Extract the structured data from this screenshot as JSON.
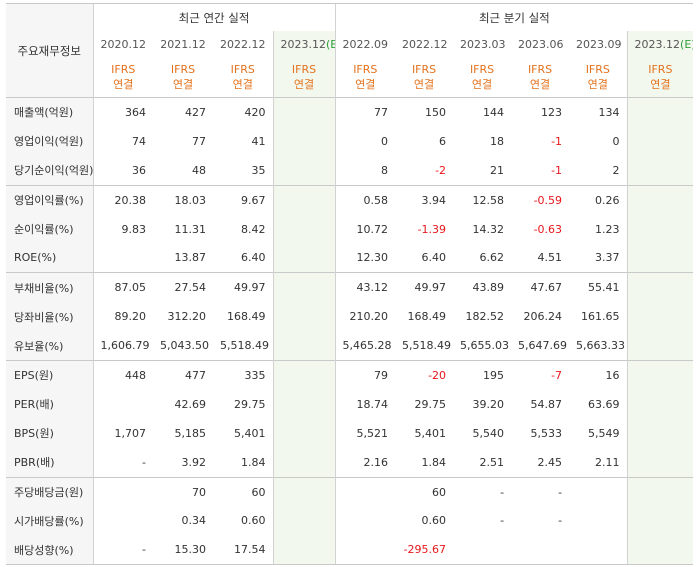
{
  "header": {
    "corner_label": "주요재무정보",
    "annual_group": "최근 연간 실적",
    "quarterly_group": "최근 분기 실적",
    "annual_periods": [
      "2020.12",
      "2021.12",
      "2022.12",
      "2023.12"
    ],
    "annual_estimate_suffix": "(E)",
    "quarterly_periods": [
      "2022.09",
      "2022.12",
      "2023.03",
      "2023.06",
      "2023.09",
      "2023.12"
    ],
    "quarterly_estimate_suffix": "(E)",
    "standard_line1": "IFRS",
    "standard_line2": "연결"
  },
  "rows": [
    {
      "label": "매출액(억원)",
      "values": [
        "364",
        "427",
        "420",
        "",
        "77",
        "150",
        "144",
        "123",
        "134",
        ""
      ]
    },
    {
      "label": "영업이익(억원)",
      "values": [
        "74",
        "77",
        "41",
        "",
        "0",
        "6",
        "18",
        "-1",
        "0",
        ""
      ]
    },
    {
      "label": "당기순이익(억원)",
      "values": [
        "36",
        "48",
        "35",
        "",
        "8",
        "-2",
        "21",
        "-1",
        "2",
        ""
      ]
    },
    {
      "label": "영업이익률(%)",
      "values": [
        "20.38",
        "18.03",
        "9.67",
        "",
        "0.58",
        "3.94",
        "12.58",
        "-0.59",
        "0.26",
        ""
      ]
    },
    {
      "label": "순이익률(%)",
      "values": [
        "9.83",
        "11.31",
        "8.42",
        "",
        "10.72",
        "-1.39",
        "14.32",
        "-0.63",
        "1.23",
        ""
      ]
    },
    {
      "label": "ROE(%)",
      "values": [
        "",
        "13.87",
        "6.40",
        "",
        "12.30",
        "6.40",
        "6.62",
        "4.51",
        "3.37",
        ""
      ]
    },
    {
      "label": "부채비율(%)",
      "values": [
        "87.05",
        "27.54",
        "49.97",
        "",
        "43.12",
        "49.97",
        "43.89",
        "47.67",
        "55.41",
        ""
      ]
    },
    {
      "label": "당좌비율(%)",
      "values": [
        "89.20",
        "312.20",
        "168.49",
        "",
        "210.20",
        "168.49",
        "182.52",
        "206.24",
        "161.65",
        ""
      ]
    },
    {
      "label": "유보율(%)",
      "values": [
        "1,606.79",
        "5,043.50",
        "5,518.49",
        "",
        "5,465.28",
        "5,518.49",
        "5,655.03",
        "5,647.69",
        "5,663.33",
        ""
      ]
    },
    {
      "label": "EPS(원)",
      "values": [
        "448",
        "477",
        "335",
        "",
        "79",
        "-20",
        "195",
        "-7",
        "16",
        ""
      ]
    },
    {
      "label": "PER(배)",
      "values": [
        "",
        "42.69",
        "29.75",
        "",
        "18.74",
        "29.75",
        "39.20",
        "54.87",
        "63.69",
        ""
      ]
    },
    {
      "label": "BPS(원)",
      "values": [
        "1,707",
        "5,185",
        "5,401",
        "",
        "5,521",
        "5,401",
        "5,540",
        "5,533",
        "5,549",
        ""
      ]
    },
    {
      "label": "PBR(배)",
      "values": [
        "-",
        "3.92",
        "1.84",
        "",
        "2.16",
        "1.84",
        "2.51",
        "2.45",
        "2.11",
        ""
      ]
    },
    {
      "label": "주당배당금(원)",
      "values": [
        "",
        "70",
        "60",
        "",
        "",
        "60",
        "-",
        "-",
        "",
        ""
      ]
    },
    {
      "label": "시가배당률(%)",
      "values": [
        "",
        "0.34",
        "0.60",
        "",
        "",
        "0.60",
        "-",
        "-",
        "",
        ""
      ]
    },
    {
      "label": "배당성향(%)",
      "values": [
        "-",
        "15.30",
        "17.54",
        "",
        "",
        "-295.67",
        "",
        "",
        "",
        ""
      ]
    }
  ],
  "colors": {
    "negative": "#e8171d",
    "standard_text": "#e4721d",
    "estimate_marker": "#2d9d3a",
    "grey_band": "#f6f6f6",
    "estimate_column": "#f3f8ee"
  }
}
